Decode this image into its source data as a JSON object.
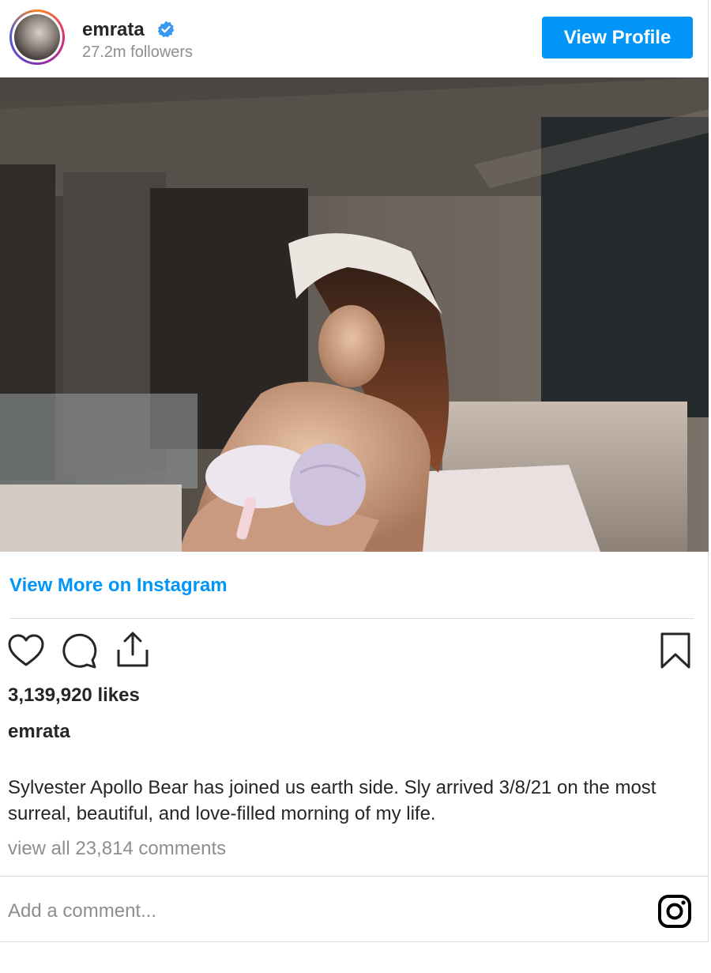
{
  "header": {
    "username": "emrata",
    "followers": "27.2m followers",
    "view_profile_label": "View Profile"
  },
  "post": {
    "view_more_label": "View More on Instagram",
    "likes": "3,139,920 likes",
    "caption_user": "emrata",
    "caption_text": "Sylvester Apollo Bear has joined us earth side. Sly arrived 3/8/21 on the most surreal, beautiful, and love-filled morning of my life.",
    "view_comments": "view all 23,814 comments",
    "add_comment_placeholder": "Add a comment..."
  },
  "icons": {
    "verified": "verified-badge-icon",
    "like": "heart-icon",
    "comment": "comment-bubble-icon",
    "share": "share-icon",
    "save": "bookmark-icon",
    "brand": "instagram-logo-icon"
  },
  "colors": {
    "accent": "#0095f6",
    "text": "#262626",
    "muted": "#8e8e8e",
    "divider": "#dbdbdb"
  }
}
